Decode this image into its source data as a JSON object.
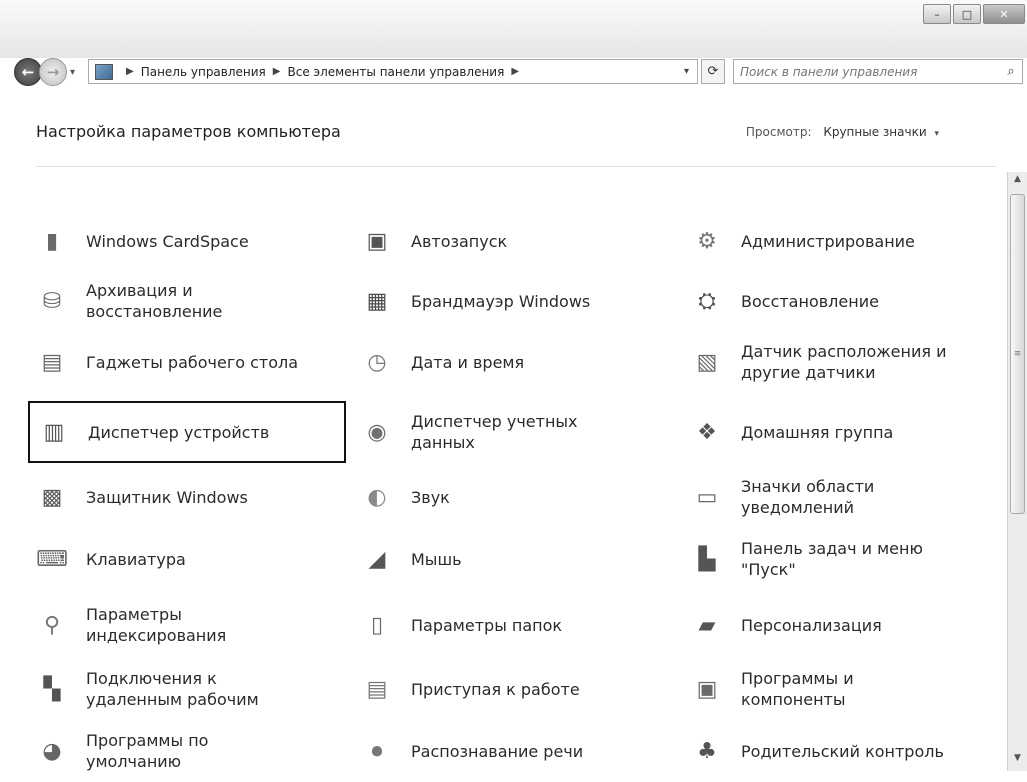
{
  "window": {
    "minimize_glyph": "–",
    "maximize_glyph": "□",
    "close_glyph": "✕"
  },
  "nav": {
    "back_glyph": "←",
    "forward_glyph": "→",
    "history_dropdown": "▾"
  },
  "address": {
    "icon": "control-panel-icon",
    "sep_glyph": "▶",
    "crumbs": [
      "Панель управления",
      "Все элементы панели управления"
    ],
    "dropdown_glyph": "▾",
    "refresh_glyph": "⟳"
  },
  "search": {
    "placeholder": "Поиск в панели управления",
    "icon_glyph": "⌕"
  },
  "header": {
    "title": "Настройка параметров компьютера",
    "view_label": "Просмотр:",
    "view_value": "Крупные значки",
    "view_dropdown": "▾"
  },
  "items": [
    {
      "label": "Windows CardSpace",
      "icon": "cardspace-icon",
      "glyph": "▮",
      "color": "#6a6a6a"
    },
    {
      "label": "Автозапуск",
      "icon": "autoplay-icon",
      "glyph": "▣",
      "color": "#555555"
    },
    {
      "label": "Администрирование",
      "icon": "admin-tools-icon",
      "glyph": "⚙",
      "color": "#777777"
    },
    {
      "label": "Архивация и восстановление",
      "icon": "backup-icon",
      "glyph": "⛁",
      "color": "#666666"
    },
    {
      "label": "Брандмауэр Windows",
      "icon": "firewall-icon",
      "glyph": "▦",
      "color": "#4a4a4a"
    },
    {
      "label": "Восстановление",
      "icon": "recovery-icon",
      "glyph": "⛭",
      "color": "#555555"
    },
    {
      "label": "Гаджеты рабочего стола",
      "icon": "gadgets-icon",
      "glyph": "▤",
      "color": "#666666"
    },
    {
      "label": "Дата и время",
      "icon": "date-time-icon",
      "glyph": "◷",
      "color": "#777777"
    },
    {
      "label": "Датчик расположения и другие датчики",
      "icon": "location-sensor-icon",
      "glyph": "▧",
      "color": "#6a6a6a"
    },
    {
      "label": "Диспетчер устройств",
      "icon": "device-manager-icon",
      "glyph": "▥",
      "color": "#555555"
    },
    {
      "label": "Диспетчер учетных данных",
      "icon": "credential-manager-icon",
      "glyph": "◉",
      "color": "#707070"
    },
    {
      "label": "Домашняя группа",
      "icon": "homegroup-icon",
      "glyph": "❖",
      "color": "#555555"
    },
    {
      "label": "Защитник Windows",
      "icon": "defender-icon",
      "glyph": "▩",
      "color": "#5a5a5a"
    },
    {
      "label": "Звук",
      "icon": "sound-icon",
      "glyph": "◐",
      "color": "#8a8a8a"
    },
    {
      "label": "Значки области уведомлений",
      "icon": "notification-icons-icon",
      "glyph": "▭",
      "color": "#6a6a6a"
    },
    {
      "label": "Клавиатура",
      "icon": "keyboard-icon",
      "glyph": "⌨",
      "color": "#666666"
    },
    {
      "label": "Мышь",
      "icon": "mouse-icon",
      "glyph": "◢",
      "color": "#555555"
    },
    {
      "label": "Панель задач и меню \"Пуск\"",
      "icon": "taskbar-icon",
      "glyph": "▙",
      "color": "#555555"
    },
    {
      "label": "Параметры индексирования",
      "icon": "indexing-icon",
      "glyph": "⚲",
      "color": "#777777"
    },
    {
      "label": "Параметры папок",
      "icon": "folder-options-icon",
      "glyph": "▯",
      "color": "#6a6a6a"
    },
    {
      "label": "Персонализация",
      "icon": "personalization-icon",
      "glyph": "▰",
      "color": "#555555"
    },
    {
      "label": "Подключения к удаленным рабочим",
      "icon": "remote-desktop-icon",
      "glyph": "▚",
      "color": "#555555"
    },
    {
      "label": "Приступая к работе",
      "icon": "getting-started-icon",
      "glyph": "▤",
      "color": "#777777"
    },
    {
      "label": "Программы и компоненты",
      "icon": "programs-features-icon",
      "glyph": "▣",
      "color": "#6a6a6a"
    },
    {
      "label": "Программы по умолчанию",
      "icon": "default-programs-icon",
      "glyph": "◕",
      "color": "#666666"
    },
    {
      "label": "Распознавание речи",
      "icon": "speech-recognition-icon",
      "glyph": "⏺",
      "color": "#777777"
    },
    {
      "label": "Родительский контроль",
      "icon": "parental-controls-icon",
      "glyph": "♣",
      "color": "#555555"
    }
  ],
  "scrollbar": {
    "up_glyph": "▲",
    "down_glyph": "▼",
    "thumb_grip": "≡"
  }
}
